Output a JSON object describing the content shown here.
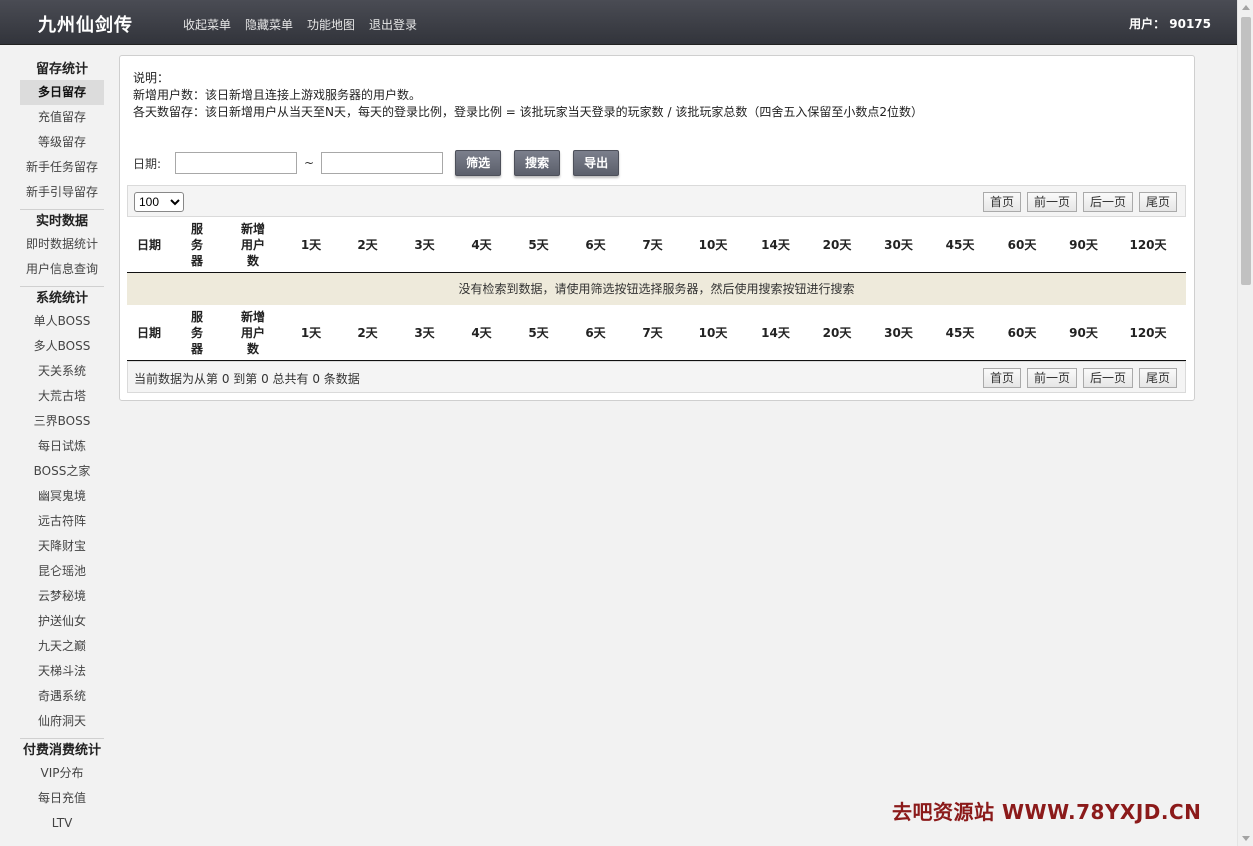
{
  "header": {
    "logo": "九州仙剑传",
    "nav": [
      "收起菜单",
      "隐藏菜单",
      "功能地图",
      "退出登录"
    ],
    "user": "用户： 90175"
  },
  "sidebar": {
    "groups": [
      {
        "title": "留存统计",
        "items": [
          "多日留存",
          "充值留存",
          "等级留存",
          "新手任务留存",
          "新手引导留存"
        ],
        "active": 0
      },
      {
        "title": "实时数据",
        "items": [
          "即时数据统计",
          "用户信息查询"
        ]
      },
      {
        "title": "系统统计",
        "items": [
          "单人BOSS",
          "多人BOSS",
          "天关系统",
          "大荒古塔",
          "三界BOSS",
          "每日试炼",
          "BOSS之家",
          "幽冥鬼境",
          "远古符阵",
          "天降财宝",
          "昆仑瑶池",
          "云梦秘境",
          "护送仙女",
          "九天之巅",
          "天梯斗法",
          "奇遇系统",
          "仙府洞天"
        ]
      },
      {
        "title": "付费消费统计",
        "items": [
          "VIP分布",
          "每日充值",
          "LTV"
        ]
      }
    ]
  },
  "description": {
    "label": "说明：",
    "line1": "新增用户数：该日新增且连接上游戏服务器的用户数。",
    "line2": "各天数留存：该日新增用户从当天至N天，每天的登录比例，登录比例 = 该批玩家当天登录的玩家数 / 该批玩家总数（四舍五入保留至小数点2位数）"
  },
  "filter": {
    "date_label": "日期:",
    "tilde": "~",
    "start_value": "",
    "end_value": "",
    "buttons": [
      "筛选",
      "搜索",
      "导出"
    ]
  },
  "table": {
    "page_size": "100",
    "page_size_options": [
      "100"
    ],
    "pager": [
      "首页",
      "前一页",
      "后一页",
      "尾页"
    ],
    "columns": [
      "日期",
      "服务器",
      "新增用户数",
      "1天",
      "2天",
      "3天",
      "4天",
      "5天",
      "6天",
      "7天",
      "10天",
      "14天",
      "20天",
      "30天",
      "45天",
      "60天",
      "90天",
      "120天"
    ],
    "empty_message": "没有检索到数据，请使用筛选按钮选择服务器，然后使用搜索按钮进行搜索",
    "footer_info": "当前数据为从第 0 到第 0 总共有 0 条数据"
  },
  "watermark": "去吧资源站  WWW.78YXJD.CN",
  "colors": {
    "header_bg": "#3a3c44",
    "empty_row_bg": "#eeeadb",
    "button_bg": "#6b6f7b",
    "watermark": "#8b1a1a"
  }
}
